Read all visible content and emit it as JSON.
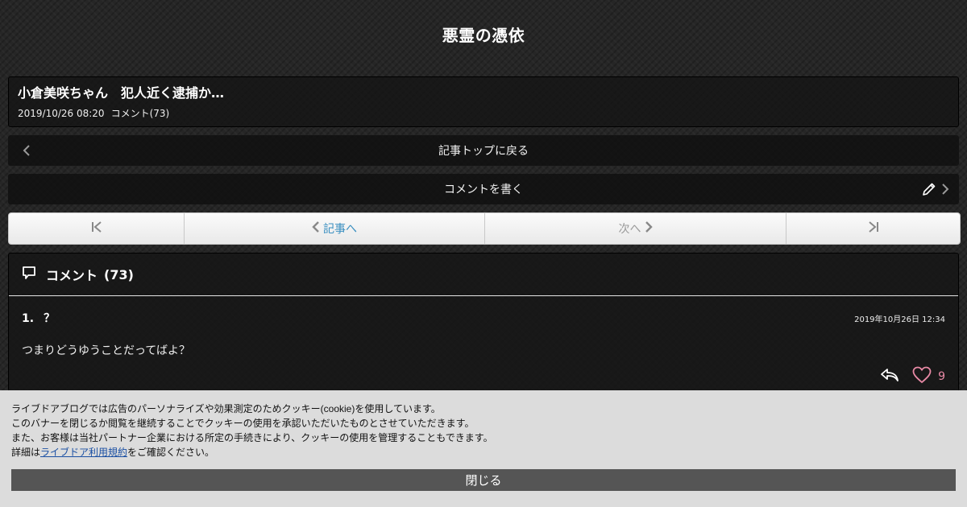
{
  "site": {
    "title": "悪霊の憑依"
  },
  "article": {
    "title": "小倉美咲ちゃん　犯人近く逮捕か…",
    "date": "2019/10/26 08:20",
    "comment_link": "コメント(73)"
  },
  "nav": {
    "back_label": "記事トップに戻る",
    "write_label": "コメントを書く"
  },
  "pager": {
    "prev_label": "記事へ",
    "next_label": "次へ"
  },
  "comments": {
    "heading": "コメント",
    "count": "(73)",
    "items": [
      {
        "number": "1.",
        "name": "？",
        "date": "2019年10月26日 12:34",
        "body": "つまりどうゆうことだってばよ？",
        "likes": "9"
      }
    ]
  },
  "cookie": {
    "line1": "ライブドアブログでは広告のパーソナライズや効果測定のためクッキー(cookie)を使用しています。",
    "line2": "このバナーを閉じるか閲覧を継続することでクッキーの使用を承認いただいたものとさせていただきます。",
    "line3": "また、お客様は当社パートナー企業における所定の手続きにより、クッキーの使用を管理することもできます。",
    "line4_prefix": "詳細は",
    "terms_link": "ライブドア利用規約",
    "line4_suffix": "をご確認ください。",
    "close_label": "閉じる"
  },
  "icons": {
    "back": "chevron-left-icon",
    "pencil": "pencil-icon",
    "forward": "chevron-right-icon",
    "first": "first-page-icon",
    "last": "last-page-icon",
    "comment": "speech-bubble-icon",
    "reply": "reply-icon",
    "like": "heart-icon"
  },
  "colors": {
    "link_blue": "#3a8fc0",
    "like_pink": "#e98aa6",
    "banner_bg": "#dcdcdc"
  }
}
